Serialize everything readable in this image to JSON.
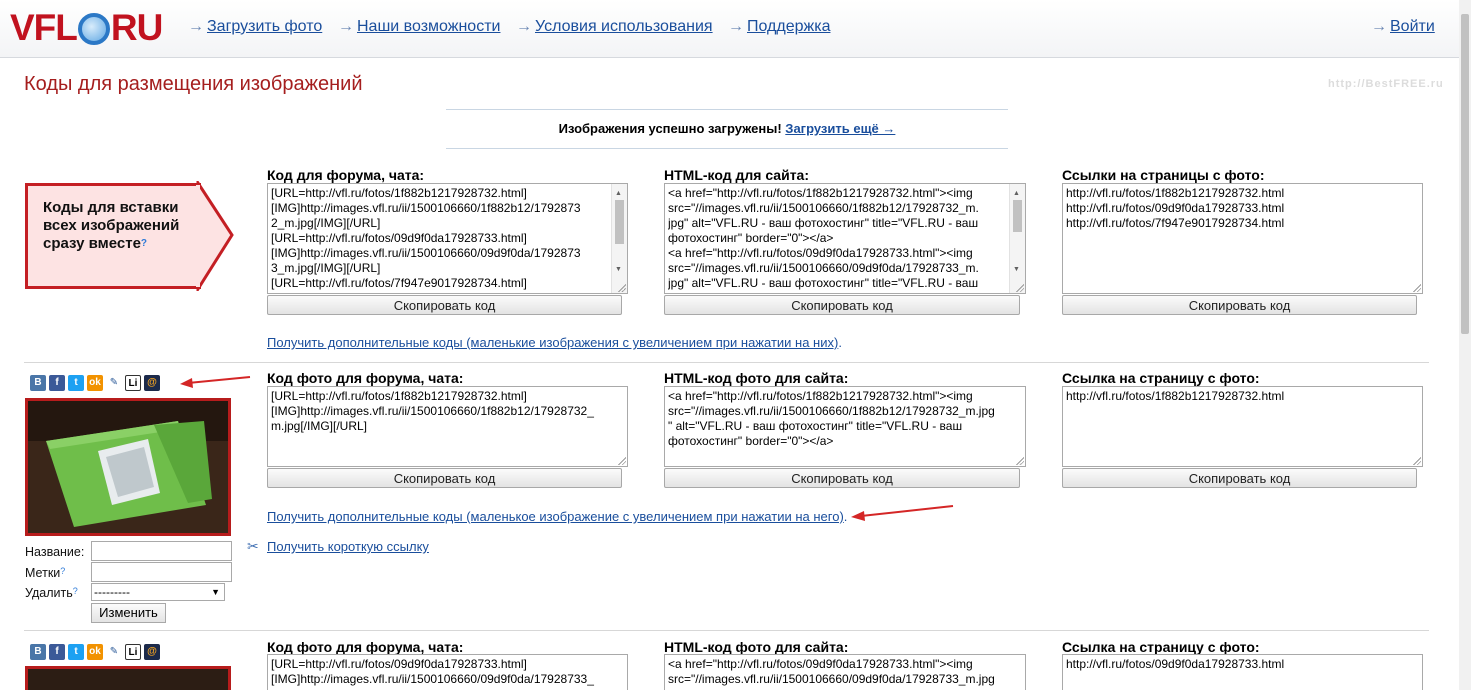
{
  "header": {
    "logo_text_left": "VFL",
    "logo_text_right": "RU",
    "nav": [
      {
        "arrow": "→",
        "label": "Загрузить фото"
      },
      {
        "arrow": "→",
        "label": "Наши возможности"
      },
      {
        "arrow": "→",
        "label": "Условия использования"
      },
      {
        "arrow": "→",
        "label": "Поддержка"
      }
    ],
    "login": {
      "arrow": "→",
      "label": "Войти"
    }
  },
  "page": {
    "title": "Коды для размещения изображений",
    "watermark": "http://BestFREE.ru"
  },
  "success": {
    "message": "Изображения успешно загружены!",
    "link": "Загрузить ещё →"
  },
  "callout": {
    "text": "Коды для вставки всех изображений сразу вместе",
    "help": "?"
  },
  "all_codes": {
    "forum_label": "Код для форума, чата:",
    "forum_lines": [
      "[URL=http://vfl.ru/fotos/1f882b1217928732.html]",
      "[IMG]http://images.vfl.ru/ii/1500106660/1f882b12/1792873",
      "2_m.jpg[/IMG][/URL]",
      "[URL=http://vfl.ru/fotos/09d9f0da17928733.html]",
      "[IMG]http://images.vfl.ru/ii/1500106660/09d9f0da/1792873",
      "3_m.jpg[/IMG][/URL]",
      "[URL=http://vfl.ru/fotos/7f947e9017928734.html]"
    ],
    "html_label": "HTML-код для сайта:",
    "html_lines": [
      "<a href=\"http://vfl.ru/fotos/1f882b1217928732.html\"><img",
      "src=\"//images.vfl.ru/ii/1500106660/1f882b12/17928732_m.",
      "jpg\" alt=\"VFL.RU - ваш фотохостинг\" title=\"VFL.RU - ваш",
      "фотохостинг\" border=\"0\"></a>",
      "<a href=\"http://vfl.ru/fotos/09d9f0da17928733.html\"><img",
      "src=\"//images.vfl.ru/ii/1500106660/09d9f0da/17928733_m.",
      "jpg\" alt=\"VFL.RU - ваш фотохостинг\" title=\"VFL.RU - ваш"
    ],
    "links_label": "Ссылки на страницы с фото:",
    "links_lines": [
      "http://vfl.ru/fotos/1f882b1217928732.html",
      "http://vfl.ru/fotos/09d9f0da17928733.html",
      "http://vfl.ru/fotos/7f947e9017928734.html"
    ],
    "copy_label": "Скопировать код",
    "more_link": "Получить дополнительные коды (маленькие изображения с увеличением при нажатии на них)",
    "more_link_end": "."
  },
  "photo1": {
    "share_icons": [
      "vkontakte-icon",
      "facebook-icon",
      "twitter-icon",
      "odnoklassniki-icon",
      "livejournal-icon",
      "liveinternet-icon",
      "mail-ru-icon"
    ],
    "share_glyphs": [
      "В",
      "f",
      "t",
      "ok",
      "✎",
      "Li",
      "@"
    ],
    "forum_label": "Код фото для форума, чата:",
    "forum_lines": [
      "[URL=http://vfl.ru/fotos/1f882b1217928732.html]",
      "[IMG]http://images.vfl.ru/ii/1500106660/1f882b12/17928732_",
      "m.jpg[/IMG][/URL]"
    ],
    "html_label": "HTML-код фото для сайта:",
    "html_lines": [
      "<a href=\"http://vfl.ru/fotos/1f882b1217928732.html\"><img",
      "src=\"//images.vfl.ru/ii/1500106660/1f882b12/17928732_m.jpg",
      "\" alt=\"VFL.RU - ваш фотохостинг\" title=\"VFL.RU - ваш",
      "фотохостинг\" border=\"0\"></a>"
    ],
    "link_label": "Ссылка на страницу с фото:",
    "link_value": "http://vfl.ru/fotos/1f882b1217928732.html",
    "copy_label": "Скопировать код",
    "more_link": "Получить дополнительные коды (маленькое изображение с увеличением при нажатии на него)",
    "more_link_end": ".",
    "short_link": "Получить короткую ссылку",
    "form": {
      "name_label": "Название:",
      "tags_label": "Метки",
      "delete_label": "Удалить",
      "delete_value": "---------",
      "help": "?",
      "submit": "Изменить"
    }
  },
  "photo2": {
    "forum_label": "Код фото для форума, чата:",
    "forum_lines": [
      "[URL=http://vfl.ru/fotos/09d9f0da17928733.html]",
      "[IMG]http://images.vfl.ru/ii/1500106660/09d9f0da/17928733_"
    ],
    "html_label": "HTML-код фото для сайта:",
    "html_lines": [
      "<a href=\"http://vfl.ru/fotos/09d9f0da17928733.html\"><img",
      "src=\"//images.vfl.ru/ii/1500106660/09d9f0da/17928733_m.jpg"
    ],
    "link_label": "Ссылка на страницу с фото:",
    "link_value": "http://vfl.ru/fotos/09d9f0da17928733.html"
  },
  "colors": {
    "brand_red": "#c1121f",
    "link_blue": "#1a4e9c",
    "annotation_red": "#c41f24"
  }
}
